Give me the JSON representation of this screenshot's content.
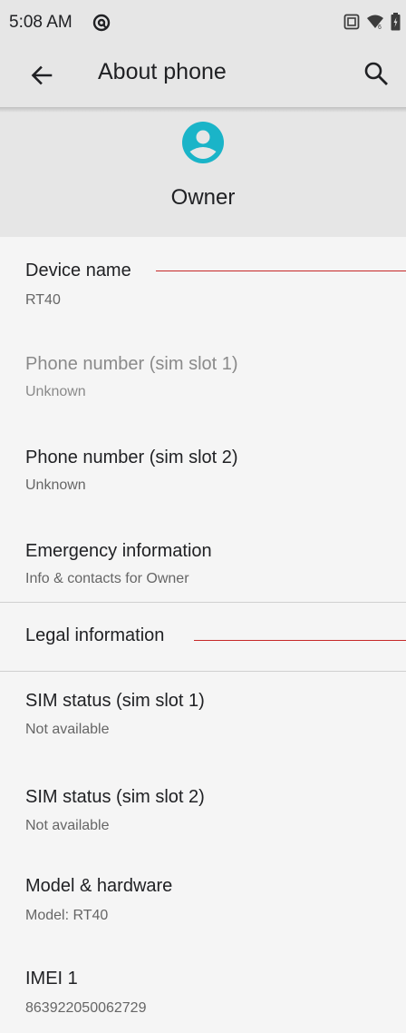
{
  "status_bar": {
    "time": "5:08 AM",
    "app_icon": "at-icon",
    "right_icons": [
      "screenshot-icon",
      "wifi-icon",
      "battery-icon"
    ]
  },
  "app_bar": {
    "title": "About phone",
    "back_icon": "back-arrow-icon",
    "search_icon": "search-icon"
  },
  "owner": {
    "name": "Owner",
    "avatar_icon": "account-circle-icon",
    "avatar_color": "#1ab4c8"
  },
  "items": [
    {
      "title": "Device name",
      "summary": "RT40",
      "enabled": true
    },
    {
      "title": "Phone number (sim slot 1)",
      "summary": "Unknown",
      "enabled": false
    },
    {
      "title": "Phone number (sim slot 2)",
      "summary": "Unknown",
      "enabled": true
    },
    {
      "title": "Emergency information",
      "summary": "Info & contacts for Owner",
      "enabled": true
    },
    {
      "title": "Legal information",
      "enabled": true
    },
    {
      "title": "SIM status (sim slot 1)",
      "summary": "Not available",
      "enabled": true
    },
    {
      "title": "SIM status (sim slot 2)",
      "summary": "Not available",
      "enabled": true
    },
    {
      "title": "Model & hardware",
      "summary": "Model: RT40",
      "enabled": true
    },
    {
      "title": "IMEI 1",
      "summary": "863922050062729",
      "enabled": true
    }
  ],
  "colors": {
    "annotation_line": "#c62828",
    "accent": "#1ab4c8"
  }
}
